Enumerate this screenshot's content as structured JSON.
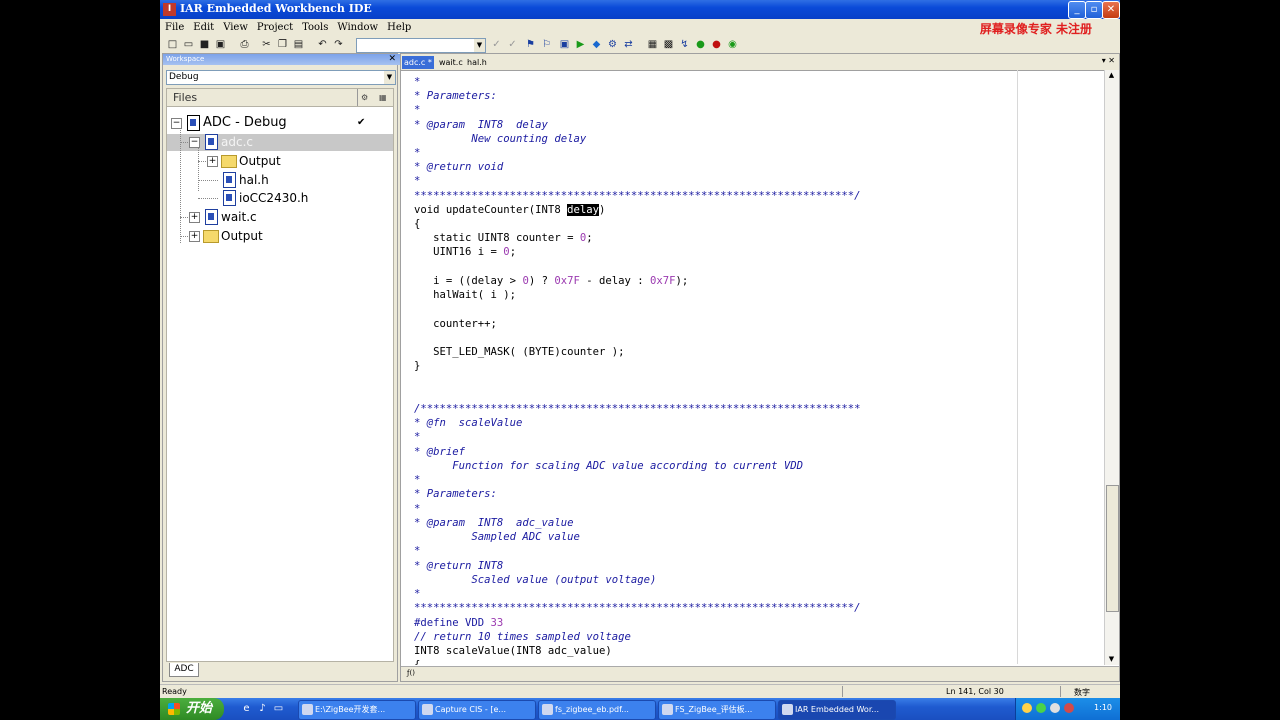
{
  "window": {
    "title": "IAR Embedded Workbench IDE",
    "min": "_",
    "max": "▫",
    "close": "✕"
  },
  "menu": [
    "File",
    "Edit",
    "View",
    "Project",
    "Tools",
    "Window",
    "Help"
  ],
  "watermark": "屏幕录像专家 未注册",
  "workspace": {
    "title": "Workspace",
    "config": "Debug",
    "files_header": "Files",
    "tree": {
      "project": "ADC - Debug",
      "adc_file": "adc.c",
      "output1": "Output",
      "hal": "hal.h",
      "io": "ioCC2430.h",
      "wait": "wait.c",
      "output2": "Output"
    },
    "tab": "ADC"
  },
  "editor": {
    "tabs": [
      "adc.c *",
      "wait.c",
      "hal.h"
    ],
    "lines": {
      "l01": "*",
      "l02": "* Parameters:",
      "l03": "*",
      "l04": "* @param  INT8  delay",
      "l05": "         New counting delay",
      "l06": "*",
      "l07": "* @return void",
      "l08": "*",
      "l09": "*********************************************************************/",
      "l10a": "void updateCounter(INT8 ",
      "l10b": "delay",
      "l10c": ")",
      "l11": "{",
      "l12": "   static UINT8 counter = ",
      "l12n": "0",
      "l12e": ";",
      "l13": "   UINT16 i = ",
      "l13n": "0",
      "l13e": ";",
      "l14a": "   i = ((delay > ",
      "l14n1": "0",
      "l14b": ") ? ",
      "l14n2": "0x7F",
      "l14c": " - delay : ",
      "l14n3": "0x7F",
      "l14d": ");",
      "l15": "   halWait( i );",
      "l16": "   counter++;",
      "l17": "   SET_LED_MASK( (BYTE)counter );",
      "l18": "}",
      "l19": "/*********************************************************************",
      "l20": "* @fn  scaleValue",
      "l21": "*",
      "l22": "* @brief",
      "l23": "      Function for scaling ADC value according to current VDD",
      "l24": "*",
      "l25": "* Parameters:",
      "l26": "*",
      "l27": "* @param  INT8  adc_value",
      "l28": "         Sampled ADC value",
      "l29": "*",
      "l30": "* @return INT8",
      "l31": "         Scaled value (output voltage)",
      "l32": "*",
      "l33": "*********************************************************************/",
      "l34a": "#define VDD ",
      "l34n": "33",
      "l35": "// return 10 times sampled voltage",
      "l36": "INT8 scaleValue(INT8 adc_value)",
      "l37": "{"
    }
  },
  "status": {
    "left": "Ready",
    "pos": "Ln 141, Col 30",
    "mode": "数字"
  },
  "taskbar": {
    "start": "开始",
    "tasks": [
      "E:\\ZigBee开发套...",
      "Capture CIS - [e...",
      "fs_zigbee_eb.pdf...",
      "FS_ZigBee_评估板...",
      "IAR Embedded Wor..."
    ],
    "clock": "1:10"
  }
}
